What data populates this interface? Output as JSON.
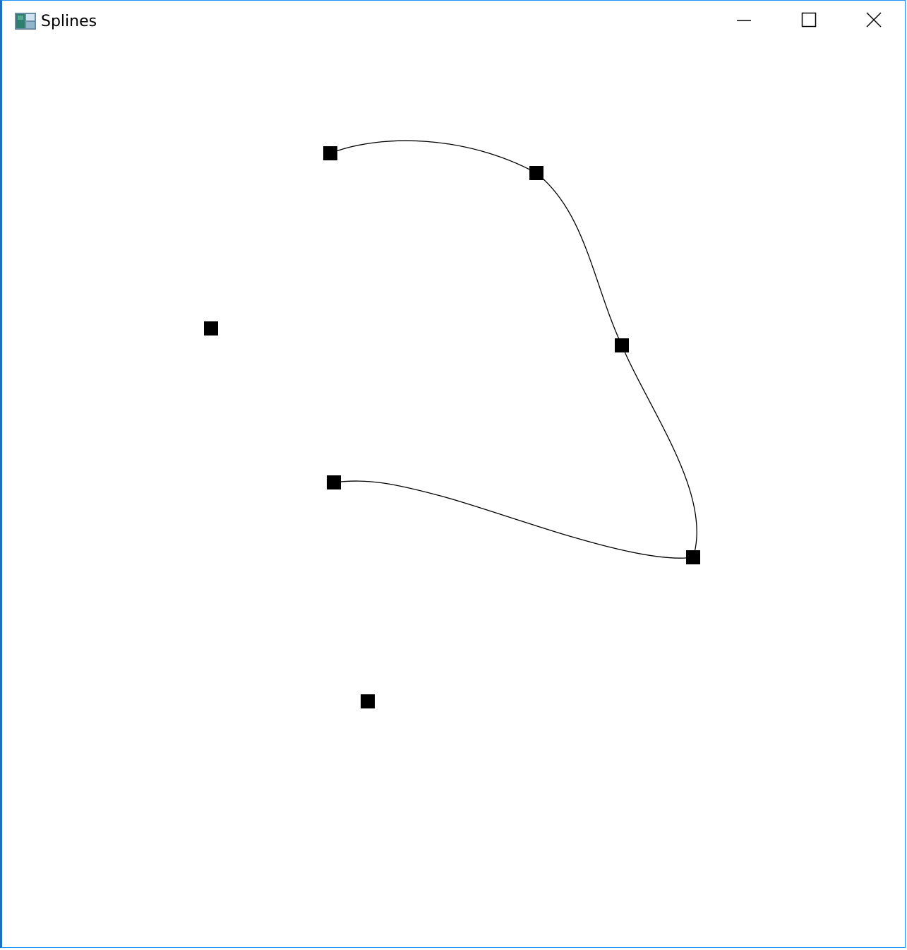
{
  "window": {
    "title": "Splines",
    "icon": "app-window-icon",
    "controls": {
      "minimize_icon": "minimize-icon",
      "maximize_icon": "maximize-icon",
      "close_icon": "close-icon"
    }
  },
  "colors": {
    "accent_border": "#1e6fbf",
    "curve": "#000000",
    "control_point": "#000000",
    "background": "#ffffff"
  }
}
